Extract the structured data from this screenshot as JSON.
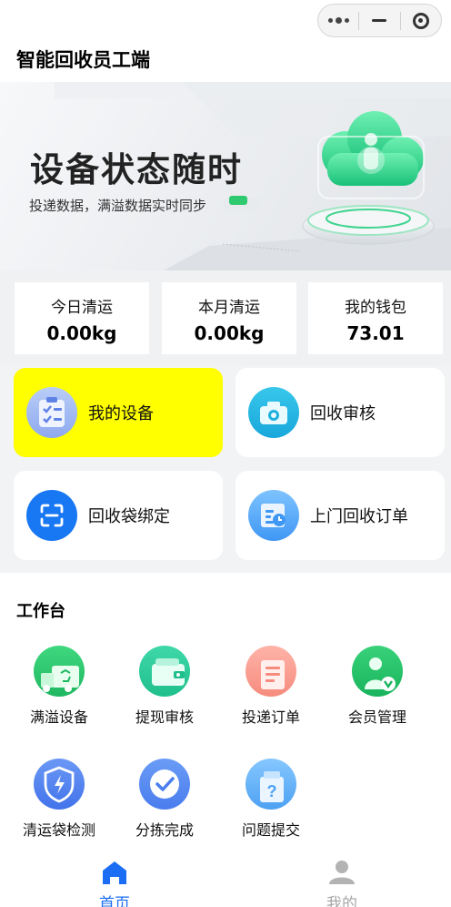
{
  "app_title": "智能回收员工端",
  "banner": {
    "title": "设备状态随时",
    "subtitle": "投递数据，满溢数据实时同步"
  },
  "stats": [
    {
      "label": "今日清运",
      "value": "0.00kg"
    },
    {
      "label": "本月清运",
      "value": "0.00kg"
    },
    {
      "label": "我的钱包",
      "value": "73.01"
    }
  ],
  "features": [
    {
      "label": "我的设备",
      "icon": "clipboard-icon",
      "highlighted": true
    },
    {
      "label": "回收审核",
      "icon": "camera-icon",
      "highlighted": false
    },
    {
      "label": "回收袋绑定",
      "icon": "scan-icon",
      "highlighted": false
    },
    {
      "label": "上门回收订单",
      "icon": "calendar-icon",
      "highlighted": false
    }
  ],
  "workbench": {
    "title": "工作台",
    "items": [
      {
        "label": "满溢设备",
        "icon": "recycle-truck-icon"
      },
      {
        "label": "提现审核",
        "icon": "wallet-icon"
      },
      {
        "label": "投递订单",
        "icon": "document-icon"
      },
      {
        "label": "会员管理",
        "icon": "member-icon"
      },
      {
        "label": "清运袋检测",
        "icon": "shield-bolt-icon"
      },
      {
        "label": "分拣完成",
        "icon": "check-icon"
      },
      {
        "label": "问题提交",
        "icon": "question-icon"
      }
    ]
  },
  "tabbar": [
    {
      "label": "首页",
      "icon": "home-icon",
      "active": true
    },
    {
      "label": "我的",
      "icon": "user-icon",
      "active": false
    }
  ],
  "colors": {
    "accent": "#1b6ef3",
    "highlight": "#ffff00",
    "green": "#2fc96f"
  }
}
